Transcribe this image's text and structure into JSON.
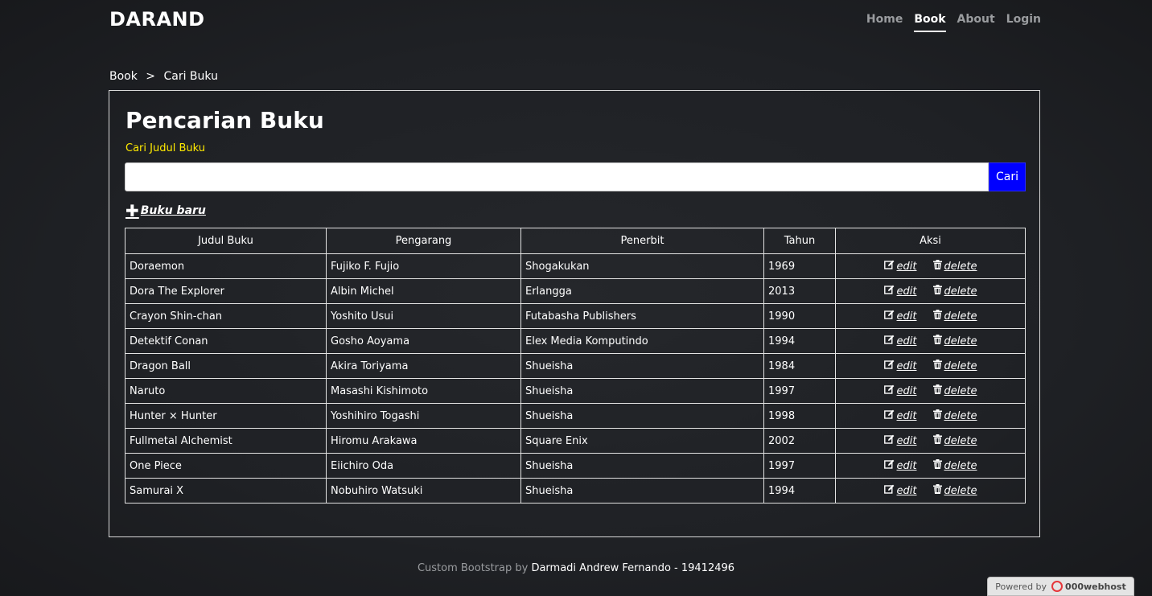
{
  "brand": "DARAND",
  "nav": [
    {
      "label": "Home",
      "active": false
    },
    {
      "label": "Book",
      "active": true
    },
    {
      "label": "About",
      "active": false
    },
    {
      "label": "Login",
      "active": false
    }
  ],
  "breadcrumb": {
    "parent": "Book",
    "separator": ">",
    "current": "Cari Buku"
  },
  "page": {
    "title": "Pencarian Buku",
    "search_label": "Cari Judul Buku",
    "search_value": "",
    "search_button": "Cari",
    "new_book": "Buku baru"
  },
  "table": {
    "headers": [
      "Judul Buku",
      "Pengarang",
      "Penerbit",
      "Tahun",
      "Aksi"
    ],
    "edit_label": "edit",
    "delete_label": "delete",
    "rows": [
      [
        "Doraemon",
        "Fujiko F. Fujio",
        "Shogakukan",
        "1969"
      ],
      [
        "Dora The Explorer",
        "Albin Michel",
        "Erlangga",
        "2013"
      ],
      [
        "Crayon Shin-chan",
        "Yoshito Usui",
        "Futabasha Publishers",
        "1990"
      ],
      [
        "Detektif Conan",
        "Gosho Aoyama",
        "Elex Media Komputindo",
        "1994"
      ],
      [
        "Dragon Ball",
        "Akira Toriyama",
        "Shueisha",
        "1984"
      ],
      [
        "Naruto",
        "Masashi Kishimoto",
        "Shueisha",
        "1997"
      ],
      [
        "Hunter × Hunter",
        "Yoshihiro Togashi",
        "Shueisha",
        "1998"
      ],
      [
        "Fullmetal Alchemist",
        "Hiromu Arakawa",
        "Square Enix",
        "2002"
      ],
      [
        "One Piece",
        "Eiichiro Oda",
        "Shueisha",
        "1997"
      ],
      [
        "Samurai X",
        "Nobuhiro Watsuki",
        "Shueisha",
        "1994"
      ]
    ]
  },
  "footer": {
    "prefix": "Custom Bootstrap by",
    "author": "Darmadi Andrew Fernando - 19412496"
  },
  "powered": {
    "prefix": "Powered by",
    "name": "000webhost"
  },
  "colors": {
    "accent_label": "#ffea00",
    "search_button": "#0000ff",
    "background": "#1f2125"
  }
}
